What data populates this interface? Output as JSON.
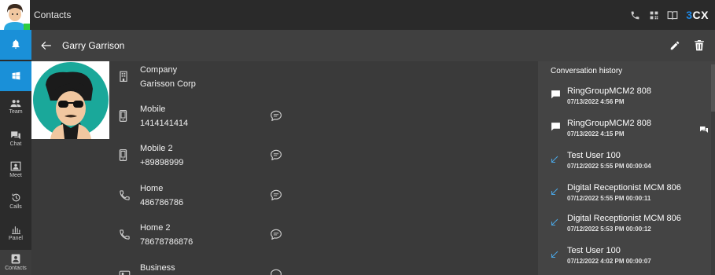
{
  "app": {
    "title": "Contacts",
    "brand": "3CX",
    "brand_prefix": "3",
    "brand_suffix": "CX"
  },
  "sidebar": {
    "items": [
      {
        "label": "",
        "icon": "bell-icon"
      },
      {
        "label": "",
        "icon": "windows-icon"
      },
      {
        "label": "Team",
        "icon": "team-icon"
      },
      {
        "label": "Chat",
        "icon": "chat-icon"
      },
      {
        "label": "Meet",
        "icon": "meet-icon"
      },
      {
        "label": "Calls",
        "icon": "history-icon"
      },
      {
        "label": "Panel",
        "icon": "panel-icon"
      },
      {
        "label": "Contacts",
        "icon": "contacts-icon"
      }
    ]
  },
  "contact": {
    "name": "Garry Garrison",
    "fields": [
      {
        "label": "Company",
        "value": "Garisson Corp",
        "icon": "building-icon",
        "chat": false
      },
      {
        "label": "Mobile",
        "value": "1414141414",
        "icon": "mobile-icon",
        "chat": true
      },
      {
        "label": "Mobile 2",
        "value": "+89898999",
        "icon": "mobile-icon",
        "chat": true
      },
      {
        "label": "Home",
        "value": "486786786",
        "icon": "phone-icon",
        "chat": true
      },
      {
        "label": "Home 2",
        "value": "78678786876",
        "icon": "phone-icon",
        "chat": true
      },
      {
        "label": "Business",
        "value": "",
        "icon": "business-phone-icon",
        "chat": true
      }
    ]
  },
  "history": {
    "title": "Conversation history",
    "items": [
      {
        "name": "RingGroupMCM2 808",
        "date": "07/13/2022 4:56 PM",
        "icon": "message-icon",
        "chat": false
      },
      {
        "name": "RingGroupMCM2 808",
        "date": "07/13/2022 4:15 PM",
        "icon": "message-icon",
        "chat": true
      },
      {
        "name": "Test User 100",
        "date": "07/12/2022 5:55 PM 00:00:04",
        "icon": "incoming-call-icon",
        "chat": false
      },
      {
        "name": "Digital Receptionist MCM 806",
        "date": "07/12/2022 5:55 PM 00:00:11",
        "icon": "incoming-call-icon",
        "chat": false
      },
      {
        "name": "Digital Receptionist MCM 806",
        "date": "07/12/2022 5:53 PM 00:00:12",
        "icon": "incoming-call-icon",
        "chat": false
      },
      {
        "name": "Test User 100",
        "date": "07/12/2022 4:02 PM 00:00:07",
        "icon": "incoming-call-icon",
        "chat": false
      }
    ]
  },
  "colors": {
    "accent": "#1a90d8",
    "brand": "#1e88e5",
    "incoming": "#4aa3df",
    "avatar_bg": "#1aa89a"
  }
}
